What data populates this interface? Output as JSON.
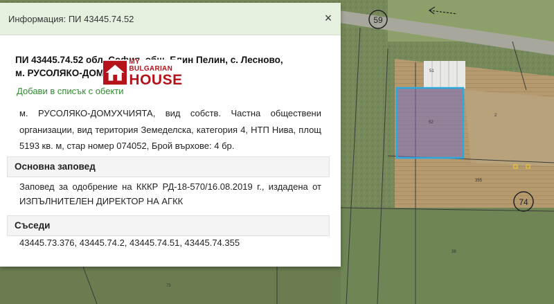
{
  "panel": {
    "title": "Информация: ПИ 43445.74.52",
    "close_symbol": "×",
    "parcel_title_line1": "ПИ 43445.74.52 обл. София, общ. Елин Пелин, с. Лесново,",
    "parcel_title_line2": "м. РУСОЛЯКО-ДОМУХЧИЯТА",
    "add_link": "Добави в списък с обекти",
    "description": "м. РУСОЛЯКО-ДОМУХЧИЯТА, вид собств. Частна обществени организации, вид територия Земеделска, категория 4, НТП Нива, площ 5193 кв. м, стар номер 074052, Брой върхове: 4 бр.",
    "order_heading": "Основна заповед",
    "order_text": "Заповед за одобрение на КККР РД-18-570/16.08.2019 г., издадена от ИЗПЪЛНИТЕЛЕН ДИРЕКТОР НА АГКК",
    "neighbours_heading": "Съседи",
    "neighbours_text": "43445.73.376, 43445.74.2, 43445.74.51, 43445.74.355"
  },
  "logo": {
    "small": "MY BULGARIAN",
    "big": "HOUSE"
  },
  "map": {
    "road_label": "59",
    "round_label": "74",
    "labels": [
      "51",
      "52",
      "2",
      "355",
      "38",
      "75"
    ]
  },
  "colors": {
    "selection": "#2aa8e0",
    "header_bg": "#e5f0de",
    "link": "#2e8b2e",
    "brand": "#b5121b"
  }
}
